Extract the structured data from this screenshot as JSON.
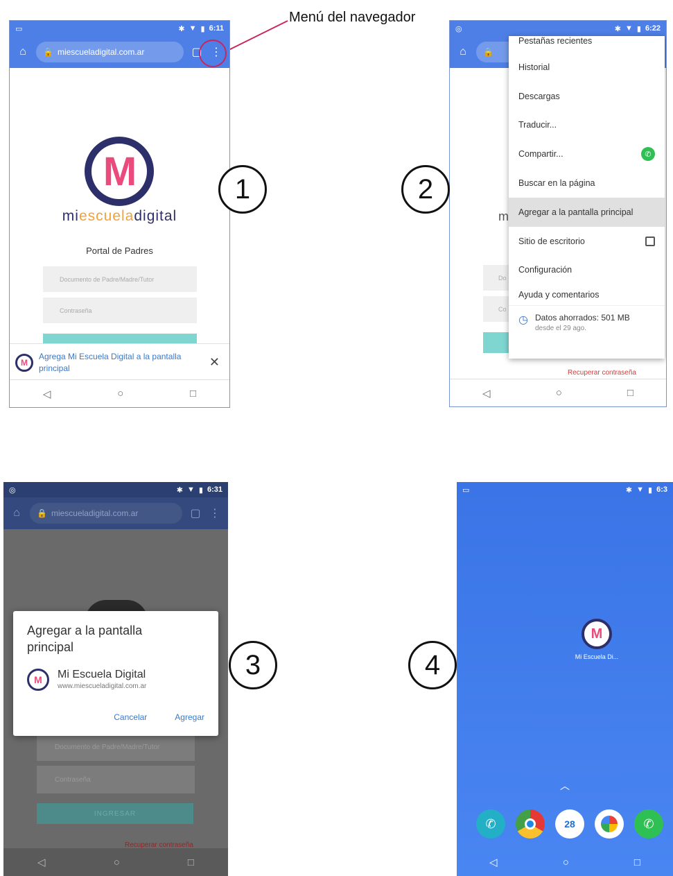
{
  "annotation": {
    "callout": "Menú del navegador",
    "step_numbers": [
      "1",
      "2",
      "3",
      "4"
    ]
  },
  "screen1": {
    "time": "6:11",
    "url": "miescueladigital.com.ar",
    "brand_parts": [
      "mi",
      "escuela",
      "digital"
    ],
    "portal_title": "Portal de Padres",
    "doc_placeholder": "Documento de Padre/Madre/Tutor",
    "pass_placeholder": "Contraseña",
    "banner_text": "Agrega Mi Escuela Digital a la pantalla principal",
    "icons": [
      "home-icon",
      "lock-icon",
      "tabs-icon",
      "menu-dots-icon",
      "close-icon"
    ]
  },
  "screen2": {
    "time": "6:22",
    "bg_letter": "m",
    "bg_field_a": "Do",
    "bg_field_b": "Co",
    "recover_link": "Recuperar contraseña",
    "menu_items": [
      "Pestañas recientes",
      "Historial",
      "Descargas",
      "Traducir...",
      "Compartir...",
      "Buscar en la página",
      "Agregar a la pantalla principal",
      "Sitio de escritorio",
      "Configuración",
      "Ayuda y comentarios"
    ],
    "saved_title": "Datos ahorrados: 501 MB",
    "saved_subtitle": "desde el 29 ago."
  },
  "screen3": {
    "time": "6:31",
    "url": "miescueladigital.com.ar",
    "dialog_title": "Agregar a la pantalla principal",
    "app_name": "Mi Escuela Digital",
    "app_url": "www.miescueladigital.com.ar",
    "cancel": "Cancelar",
    "add": "Agregar",
    "doc_placeholder": "Documento de Padre/Madre/Tutor",
    "pass_placeholder": "Contraseña",
    "login_button": "INGRESAR",
    "recover_link": "Recuperar contraseña"
  },
  "screen4": {
    "time": "6:3",
    "app_label": "Mi Escuela Di...",
    "calendar_day": "28",
    "dock_apps": [
      "phone-icon",
      "chrome-icon",
      "calendar-icon",
      "photos-icon",
      "whatsapp-icon"
    ]
  },
  "colors": {
    "chrome_blue": "#4e7fe6",
    "logo_navy": "#2d2f6b",
    "logo_pink": "#e94c7c",
    "link_blue": "#3a78c9",
    "annotation_ring": "#c8265d"
  }
}
